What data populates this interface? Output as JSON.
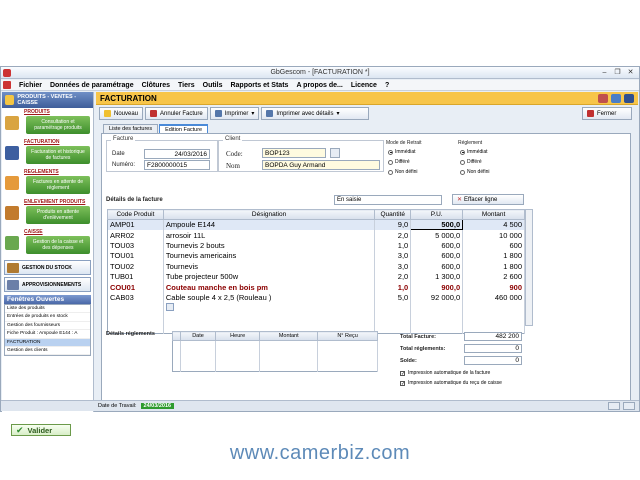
{
  "window": {
    "title": "GbGescom - [FACTURATION *]"
  },
  "menu": [
    "Fichier",
    "Données de paramétrage",
    "Clôtures",
    "Tiers",
    "Outils",
    "Rapports et Stats",
    "A propos de...",
    "Licence",
    "?"
  ],
  "sidebar": {
    "header": "PRODUITS - VENTES - CAISSE",
    "sections": [
      {
        "title": "PRODUITS",
        "button": "Consultation et paramétrage produits",
        "color": "#d9a441"
      },
      {
        "title": "FACTURATION",
        "button": "Facturation et historique de factures",
        "color": "#3d5fa0"
      },
      {
        "title": "REGLEMENTS",
        "button": "Factures en attente de réglement",
        "color": "#e59a3b"
      },
      {
        "title": "ENLEVEMENT PRODUITS",
        "button": "Produits en attente d'enlèvement",
        "color": "#c27b2d"
      },
      {
        "title": "CAISSE",
        "button": "Gestion de la caisse et des dépenses",
        "color": "#6aa84f"
      }
    ],
    "big_buttons": [
      "GESTION DU STOCK",
      "APPROVISIONNEMENTS"
    ],
    "open_windows_title": "Fenêtres Ouvertes",
    "open_windows": [
      "Liste des produits",
      "Entrées de produits en stock",
      "Gestion des fournisseurs",
      "Fiche Produit : Ampoule  E144 : A",
      "FACTURATION",
      "Gestion des clients"
    ],
    "selected_window": "FACTURATION"
  },
  "header": {
    "title": "FACTURATION"
  },
  "toolbar": {
    "nouveau": "Nouveau",
    "annuler": "Annuler Facture",
    "imprimer": "Imprimer",
    "imprimer_details": "Imprimer avec détails",
    "fermer": "Fermer"
  },
  "tabs": [
    "Liste des factures",
    "Edition Facture"
  ],
  "facture": {
    "legend": "Facture",
    "date_label": "Date",
    "date": "24/03/2016",
    "numero_label": "Numéro:",
    "numero": "F2800000015"
  },
  "client": {
    "legend": "Client",
    "code_label": "Code:",
    "code": "BOP123",
    "nom_label": "Nom",
    "nom": "BOPDA Guy Armand"
  },
  "mode_retrait": {
    "legend": "Mode de Retrait",
    "options": [
      "Immédiat",
      "Différé",
      "Non défini"
    ],
    "selected": "Immédiat"
  },
  "reglement": {
    "legend": "Réglement",
    "options": [
      "Immédiat",
      "Différé",
      "Non défini"
    ],
    "selected": "Immédiat"
  },
  "details": {
    "title": "Détails de la facture",
    "saisie": "En saisie",
    "effacer": "Effacer ligne",
    "columns": [
      "Code Produit",
      "Désignation",
      "Quantité",
      "P.U.",
      "Montant"
    ],
    "rows": [
      {
        "code": "AMP01",
        "designation": "Ampoule  E144",
        "quantite": "9,0",
        "pu": "500,0",
        "montant": "4 500"
      },
      {
        "code": "ARR02",
        "designation": "arrosoir 11L",
        "quantite": "2,0",
        "pu": "5 000,0",
        "montant": "10 000"
      },
      {
        "code": "TOU03",
        "designation": "Tournevis 2 bouts",
        "quantite": "1,0",
        "pu": "600,0",
        "montant": "600"
      },
      {
        "code": "TOU01",
        "designation": "Tournevis americains",
        "quantite": "3,0",
        "pu": "600,0",
        "montant": "1 800"
      },
      {
        "code": "TOU02",
        "designation": "Tournevis",
        "quantite": "3,0",
        "pu": "600,0",
        "montant": "1 800"
      },
      {
        "code": "TUB01",
        "designation": "Tube projecteur 500w",
        "quantite": "2,0",
        "pu": "1 300,0",
        "montant": "2 600"
      },
      {
        "code": "COU01",
        "designation": "Couteau manche en bois pm",
        "quantite": "1,0",
        "pu": "900,0",
        "montant": "900"
      },
      {
        "code": "CAB03",
        "designation": "Cable souple 4 x 2,5 (Rouleau )",
        "quantite": "5,0",
        "pu": "92 000,0",
        "montant": "460 000"
      }
    ]
  },
  "reglements": {
    "title": "Détails réglements",
    "columns": [
      "Date",
      "Heure",
      "Montant",
      "N° Reçu"
    ]
  },
  "totals": {
    "total_label": "Total Facture:",
    "total": "482 200",
    "reglements_label": "Total réglements:",
    "reglements": "0",
    "solde_label": "Solde:",
    "solde": "0"
  },
  "checks": [
    "Impression automatique de la facture",
    "Impression automatique du reçu de caisse"
  ],
  "valider": "Valider",
  "status": {
    "label": "Date de Travail:",
    "date": "24/03/2016"
  },
  "watermark": "www.camerbiz.com"
}
